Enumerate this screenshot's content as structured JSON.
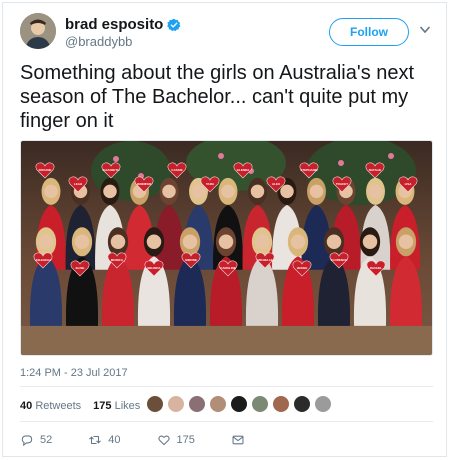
{
  "user": {
    "display_name": "brad esposito",
    "handle": "@braddybb",
    "verified": true,
    "avatar_icon": "avatar-photo"
  },
  "follow_label": "Follow",
  "tweet_text": "Something about the girls on Australia's next season of The Bachelor... can't quite put my finger on it",
  "photo": {
    "description_icon": "group-photo",
    "heart_labels": [
      "ROXANE",
      "LEAH",
      "ELIZABETH",
      "JENNIFER",
      "CASSIE",
      "TARA",
      "GLENDA",
      "ALEX",
      "STEPHANIE",
      "TRACEY",
      "NATALIE",
      "LISA",
      "ASHLEIGH",
      "ELISE",
      "MONICA",
      "BELINDA",
      "SIMONE",
      "CAROLINE",
      "MICHELLE",
      "JESSIE",
      "FLORENCE",
      "RACHEL"
    ]
  },
  "timestamp": "1:24 PM - 23 Jul 2017",
  "stats": {
    "retweets_count": "40",
    "retweets_label": "Retweets",
    "likes_count": "175",
    "likes_label": "Likes"
  },
  "actions": {
    "reply_count": "52",
    "retweet_count": "40",
    "like_count": "175"
  },
  "colors": {
    "accent": "#1da1f2",
    "text": "#14171a",
    "muted": "#657786"
  }
}
